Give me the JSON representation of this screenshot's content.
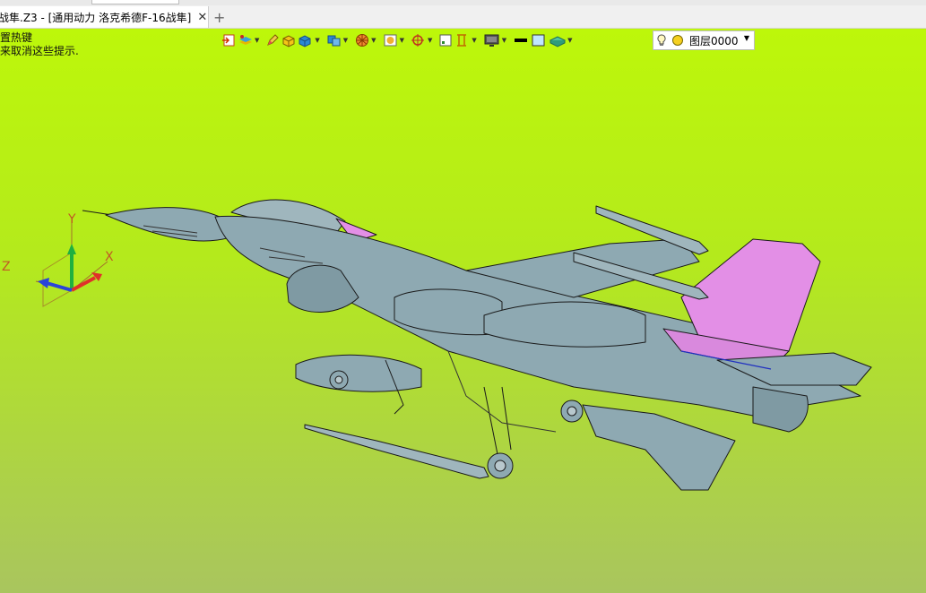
{
  "tab": {
    "title": "战隼.Z3 - [通用动力 洛克希德F-16战隼]",
    "close_glyph": "✕"
  },
  "new_tab_glyph": "+",
  "hint": {
    "line1": "置热键",
    "line2": "来取消这些提示."
  },
  "layer": {
    "value": "图层0000"
  },
  "axes": {
    "x": "X",
    "y": "Y",
    "z": "Z"
  },
  "colors": {
    "viewport_top": "#bdf70a",
    "viewport_bottom": "#a9c55e",
    "model_fill": "#8ea9b2",
    "highlight": "#e38fe6"
  }
}
